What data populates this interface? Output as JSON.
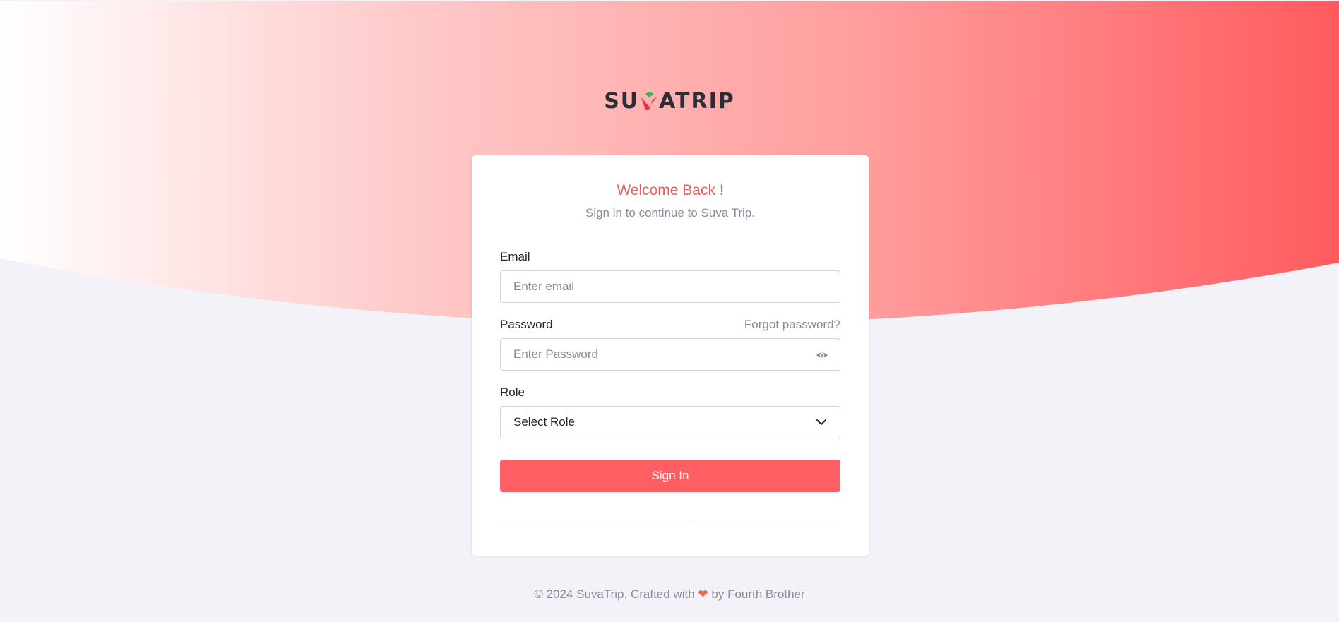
{
  "brand": {
    "logo_text_left": "SU",
    "logo_text_right": "ATRIP",
    "accent": "#ff5e63",
    "title_color": "#ee5b5b"
  },
  "login": {
    "title": "Welcome Back !",
    "subtitle": "Sign in to continue to Suva Trip.",
    "email_label": "Email",
    "email_placeholder": "Enter email",
    "password_label": "Password",
    "forgot_label": "Forgot password?",
    "password_placeholder": "Enter Password",
    "password_toggle_icon": "eye-icon",
    "role_label": "Role",
    "role_value": "Select Role",
    "role_icon": "chevron-down-icon",
    "submit_label": "Sign In"
  },
  "footer": {
    "prefix": "© 2024 SuvaTrip. Crafted with",
    "heart_icon": "heart-icon",
    "suffix": "by Fourth Brother"
  }
}
